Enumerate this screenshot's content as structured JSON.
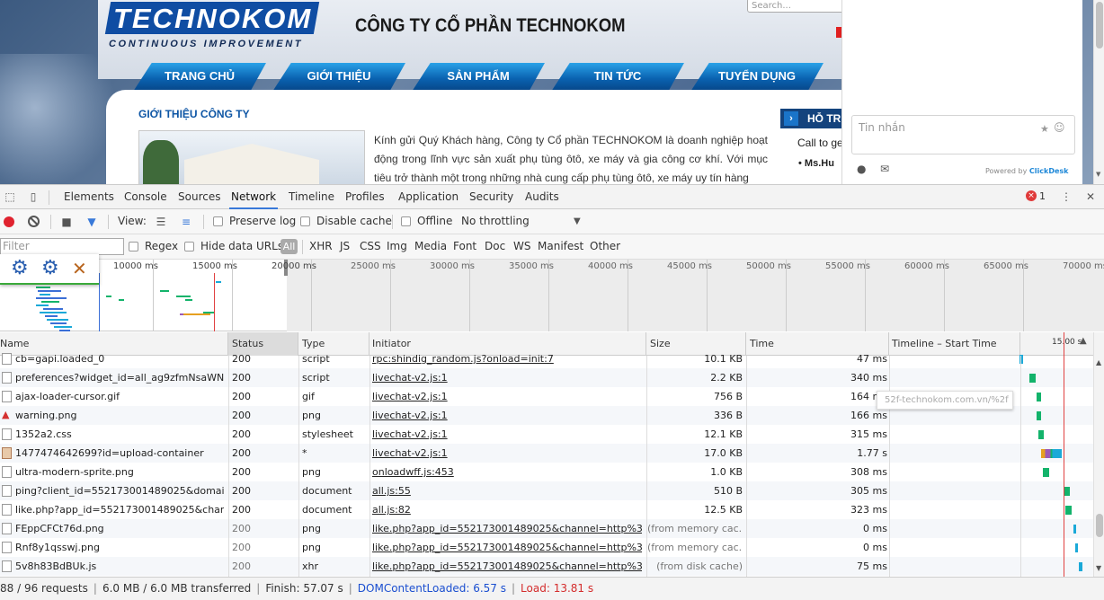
{
  "site": {
    "logo_text": "TECHNOKOM",
    "logo_sub": "CONTINUOUS IMPROVEMENT",
    "company": "CÔNG TY CỔ PHẦN TECHNOKOM",
    "search_placeholder": "Search...",
    "nav": [
      "TRANG CHỦ",
      "GIỚI THIỆU",
      "SẢN PHẨM",
      "TIN TỨC",
      "TUYỂN DỤNG"
    ],
    "intro_title": "GIỚI THIỆU CÔNG TY",
    "intro_text": "Kính gửi Quý Khách hàng, Công ty Cổ phần TECHNOKOM là doanh nghiệp hoạt động trong lĩnh vực sản xuất phụ tùng ôtô, xe máy và gia công cơ khí. Với mục tiêu trở thành một trong những nhà cung cấp phụ tùng ôtô, xe máy uy tín hàng",
    "support_title": "HỖ TR",
    "support_call": "Call to ge",
    "support_person": "• Ms.Hu"
  },
  "chat": {
    "input_placeholder": "Tin nhắn",
    "powered_prefix": "Powered by",
    "powered_brand": "ClickDesk"
  },
  "devtools": {
    "tabs": [
      "Elements",
      "Console",
      "Sources",
      "Network",
      "Timeline",
      "Profiles",
      "Application",
      "Security",
      "Audits"
    ],
    "active_tab": "Network",
    "error_count": "1",
    "toolbar": {
      "view_label": "View:",
      "preserve_log": "Preserve log",
      "disable_cache": "Disable cache",
      "offline": "Offline",
      "throttling": "No throttling"
    },
    "filter": {
      "placeholder": "Filter",
      "regex": "Regex",
      "hide_data_urls": "Hide data URLs",
      "types": [
        "All",
        "XHR",
        "JS",
        "CSS",
        "Img",
        "Media",
        "Font",
        "Doc",
        "WS",
        "Manifest",
        "Other"
      ]
    },
    "overview_ticks": [
      "10000 ms",
      "15000 ms",
      "20000 ms",
      "25000 ms",
      "30000 ms",
      "35000 ms",
      "40000 ms",
      "45000 ms",
      "50000 ms",
      "55000 ms",
      "60000 ms",
      "65000 ms",
      "70000 ms"
    ],
    "columns": [
      "Name",
      "Status",
      "Type",
      "Initiator",
      "Size",
      "Time",
      "Timeline – Start Time"
    ],
    "waterfall_label": "15.00 s",
    "tooltip": "52f-technokom.com.vn/%2f",
    "rows": [
      {
        "name": "cb=gapi.loaded_0",
        "status": "200",
        "type": "script",
        "initiator": "rpc:shindig_random.js?onload=init:7",
        "size": "10.1 KB",
        "time": "47 ms",
        "icon": "file"
      },
      {
        "name": "preferences?widget_id=all_ag9zfmNsaWNr...",
        "status": "200",
        "type": "script",
        "initiator": "livechat-v2.js:1",
        "size": "2.2 KB",
        "time": "340 ms",
        "icon": "file"
      },
      {
        "name": "ajax-loader-cursor.gif",
        "status": "200",
        "type": "gif",
        "initiator": "livechat-v2.js:1",
        "size": "756 B",
        "time": "164 ms",
        "icon": "file"
      },
      {
        "name": "warning.png",
        "status": "200",
        "type": "png",
        "initiator": "livechat-v2.js:1",
        "size": "336 B",
        "time": "166 ms",
        "icon": "warn"
      },
      {
        "name": "1352a2.css",
        "status": "200",
        "type": "stylesheet",
        "initiator": "livechat-v2.js:1",
        "size": "12.1 KB",
        "time": "315 ms",
        "icon": "file"
      },
      {
        "name": "1477474642699?id=upload-container",
        "status": "200",
        "type": "*",
        "initiator": "livechat-v2.js:1",
        "size": "17.0 KB",
        "time": "1.77 s",
        "icon": "img"
      },
      {
        "name": "ultra-modern-sprite.png",
        "status": "200",
        "type": "png",
        "initiator": "onloadwff.js:453",
        "size": "1.0 KB",
        "time": "308 ms",
        "icon": "file"
      },
      {
        "name": "ping?client_id=552173001489025&domain=...",
        "status": "200",
        "type": "document",
        "initiator": "all.js:55",
        "size": "510 B",
        "time": "305 ms",
        "icon": "file"
      },
      {
        "name": "like.php?app_id=552173001489025&channe...",
        "status": "200",
        "type": "document",
        "initiator": "all.js:82",
        "size": "12.5 KB",
        "time": "323 ms",
        "icon": "file"
      },
      {
        "name": "FEppCFCt76d.png",
        "status": "200",
        "type": "png",
        "initiator": "like.php?app_id=552173001489025&channel=http%3A%2...",
        "size": "(from memory cac...",
        "time": "0 ms",
        "icon": "file",
        "cached": true
      },
      {
        "name": "Rnf8y1qsswj.png",
        "status": "200",
        "type": "png",
        "initiator": "like.php?app_id=552173001489025&channel=http%3A%2...",
        "size": "(from memory cac...",
        "time": "0 ms",
        "icon": "file",
        "cached": true
      },
      {
        "name": "5v8h83BdBUk.js",
        "status": "200",
        "type": "xhr",
        "initiator": "like.php?app_id=552173001489025&channel=http%3A%2...",
        "size": "(from disk cache)",
        "time": "75 ms",
        "icon": "file",
        "cached": true
      }
    ],
    "status": {
      "requests": "88 / 96 requests",
      "transferred": "6.0 MB / 6.0 MB transferred",
      "finish": "Finish: 57.07 s",
      "dcl": "DOMContentLoaded: 6.57 s",
      "load": "Load: 13.81 s"
    }
  },
  "colors": {
    "accent": "#3879d9",
    "record": "#e0232f",
    "dcl": "#1a4ed0",
    "load": "#d42c2c"
  }
}
